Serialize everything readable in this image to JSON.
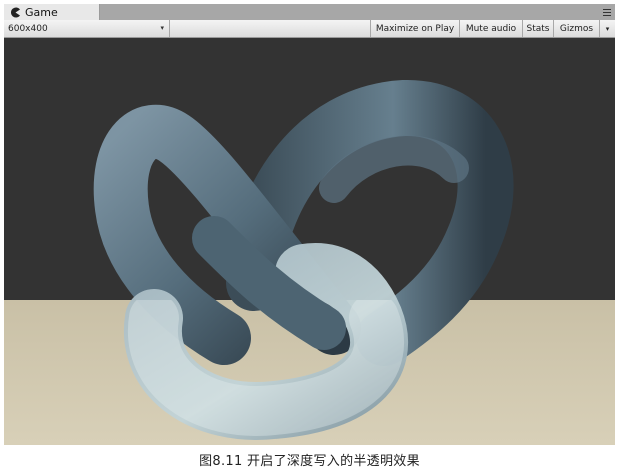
{
  "window": {
    "tab_title": "Game",
    "tab_icon": "pacman-game-icon",
    "tab_menu_icon": "tab-menu-icon"
  },
  "toolbar": {
    "resolution": "600x400",
    "maximize_label": "Maximize on Play",
    "mute_label": "Mute audio",
    "stats_label": "Stats",
    "gizmos_label": "Gizmos"
  },
  "scene": {
    "object": "torus-knot",
    "background_color": "#323232",
    "floor_color": "#d0c6ac",
    "knot_color": "#6f8796"
  },
  "caption": "图8.11 开启了深度写入的半透明效果"
}
